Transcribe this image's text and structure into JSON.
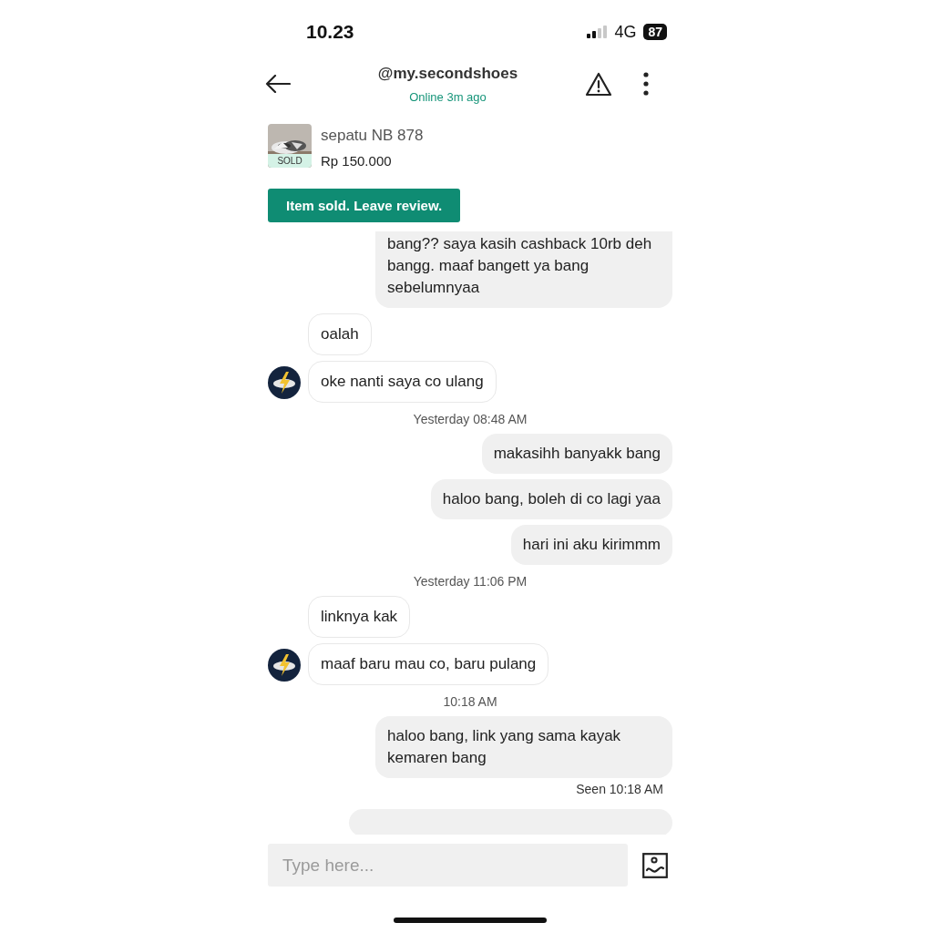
{
  "status_bar": {
    "time": "10.23",
    "network": "4G",
    "battery": "87"
  },
  "header": {
    "title": "@my.secondshoes",
    "subtitle": "Online 3m ago"
  },
  "product": {
    "kind": "picture",
    "badge": "SOLD",
    "name": "sepatu NB 878",
    "price": "Rp 150.000"
  },
  "review_button": "Item sold. Leave review.",
  "messages": [
    {
      "kind": "outgoing",
      "text": "bang?? saya kasih cashback 10rb deh bangg. maaf bangett ya bang sebelumnyaa",
      "clipped": true
    },
    {
      "kind": "incoming",
      "text": "oalah",
      "avatar": false
    },
    {
      "kind": "incoming",
      "text": "oke nanti saya co ulang",
      "avatar": true
    },
    {
      "kind": "time",
      "text": "Yesterday 08:48 AM"
    },
    {
      "kind": "outgoing",
      "text": "makasihh banyakk bang",
      "clipped": false
    },
    {
      "kind": "outgoing",
      "text": "haloo bang, boleh di co lagi yaa",
      "clipped": false
    },
    {
      "kind": "outgoing",
      "text": "hari ini aku kirimmm",
      "clipped": false
    },
    {
      "kind": "time",
      "text": "Yesterday 11:06 PM"
    },
    {
      "kind": "incoming",
      "text": "linknya kak",
      "avatar": false
    },
    {
      "kind": "incoming",
      "text": "maaf baru mau co, baru pulang",
      "avatar": true
    },
    {
      "kind": "time",
      "text": "10:18 AM"
    },
    {
      "kind": "outgoing",
      "text": "haloo bang, link yang sama kayak kemaren bang",
      "clipped": false
    },
    {
      "kind": "seen",
      "text": "Seen 10:18 AM"
    },
    {
      "kind": "partial"
    }
  ],
  "composer": {
    "placeholder": "Type here..."
  }
}
